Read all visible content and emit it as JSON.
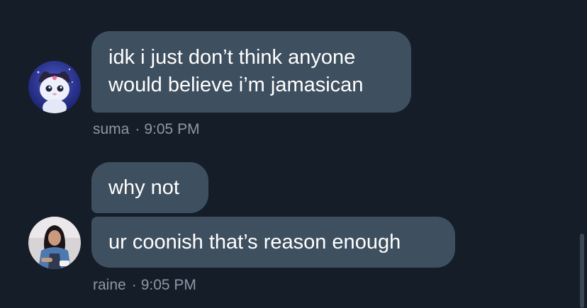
{
  "messages": [
    {
      "sender": "suma",
      "time": "9:05 PM",
      "separator": "·",
      "bubbles": [
        {
          "lines": [
            "idk i just don’t think anyone",
            "would believe i’m jamasican"
          ]
        }
      ]
    },
    {
      "sender": "raine",
      "time": "9:05 PM",
      "separator": "·",
      "bubbles": [
        {
          "lines": [
            "why not"
          ]
        },
        {
          "lines": [
            "ur coonish that’s reason enough"
          ]
        }
      ]
    }
  ],
  "colors": {
    "background": "#151d28",
    "bubble": "#3e4f5f",
    "text": "#ffffff",
    "meta_text": "#8a98a6"
  },
  "icons": {
    "suma_avatar": "anime-character-avatar",
    "raine_avatar": "person-photo-avatar"
  }
}
